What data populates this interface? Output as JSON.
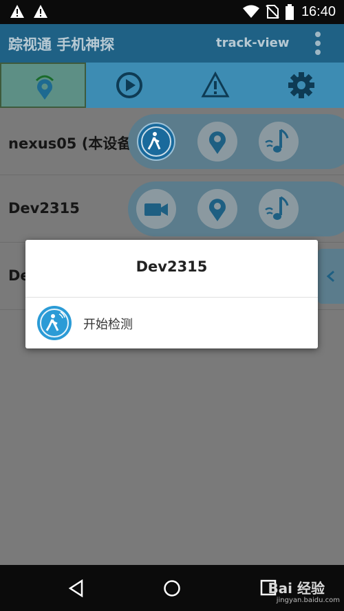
{
  "status_bar": {
    "time": "16:40"
  },
  "app_bar": {
    "title": "踪视通 手机神探",
    "account": "track-view"
  },
  "tabs": [
    {
      "icon": "location-signal-icon",
      "active": true
    },
    {
      "icon": "play-icon",
      "active": false
    },
    {
      "icon": "warning-icon",
      "active": false
    },
    {
      "icon": "gear-icon",
      "active": false
    }
  ],
  "devices": [
    {
      "name": "nexus05 (本设备",
      "actions": [
        "motion-detect-icon",
        "location-icon",
        "sound-icon"
      ]
    },
    {
      "name": "Dev2315",
      "actions": [
        "video-camera-icon",
        "location-icon",
        "sound-icon"
      ]
    },
    {
      "name": "De"
    }
  ],
  "dialog": {
    "title": "Dev2315",
    "item_label": "开始检测"
  },
  "watermark": {
    "brand": "Bai 经验",
    "url": "jingyan.baidu.com"
  }
}
